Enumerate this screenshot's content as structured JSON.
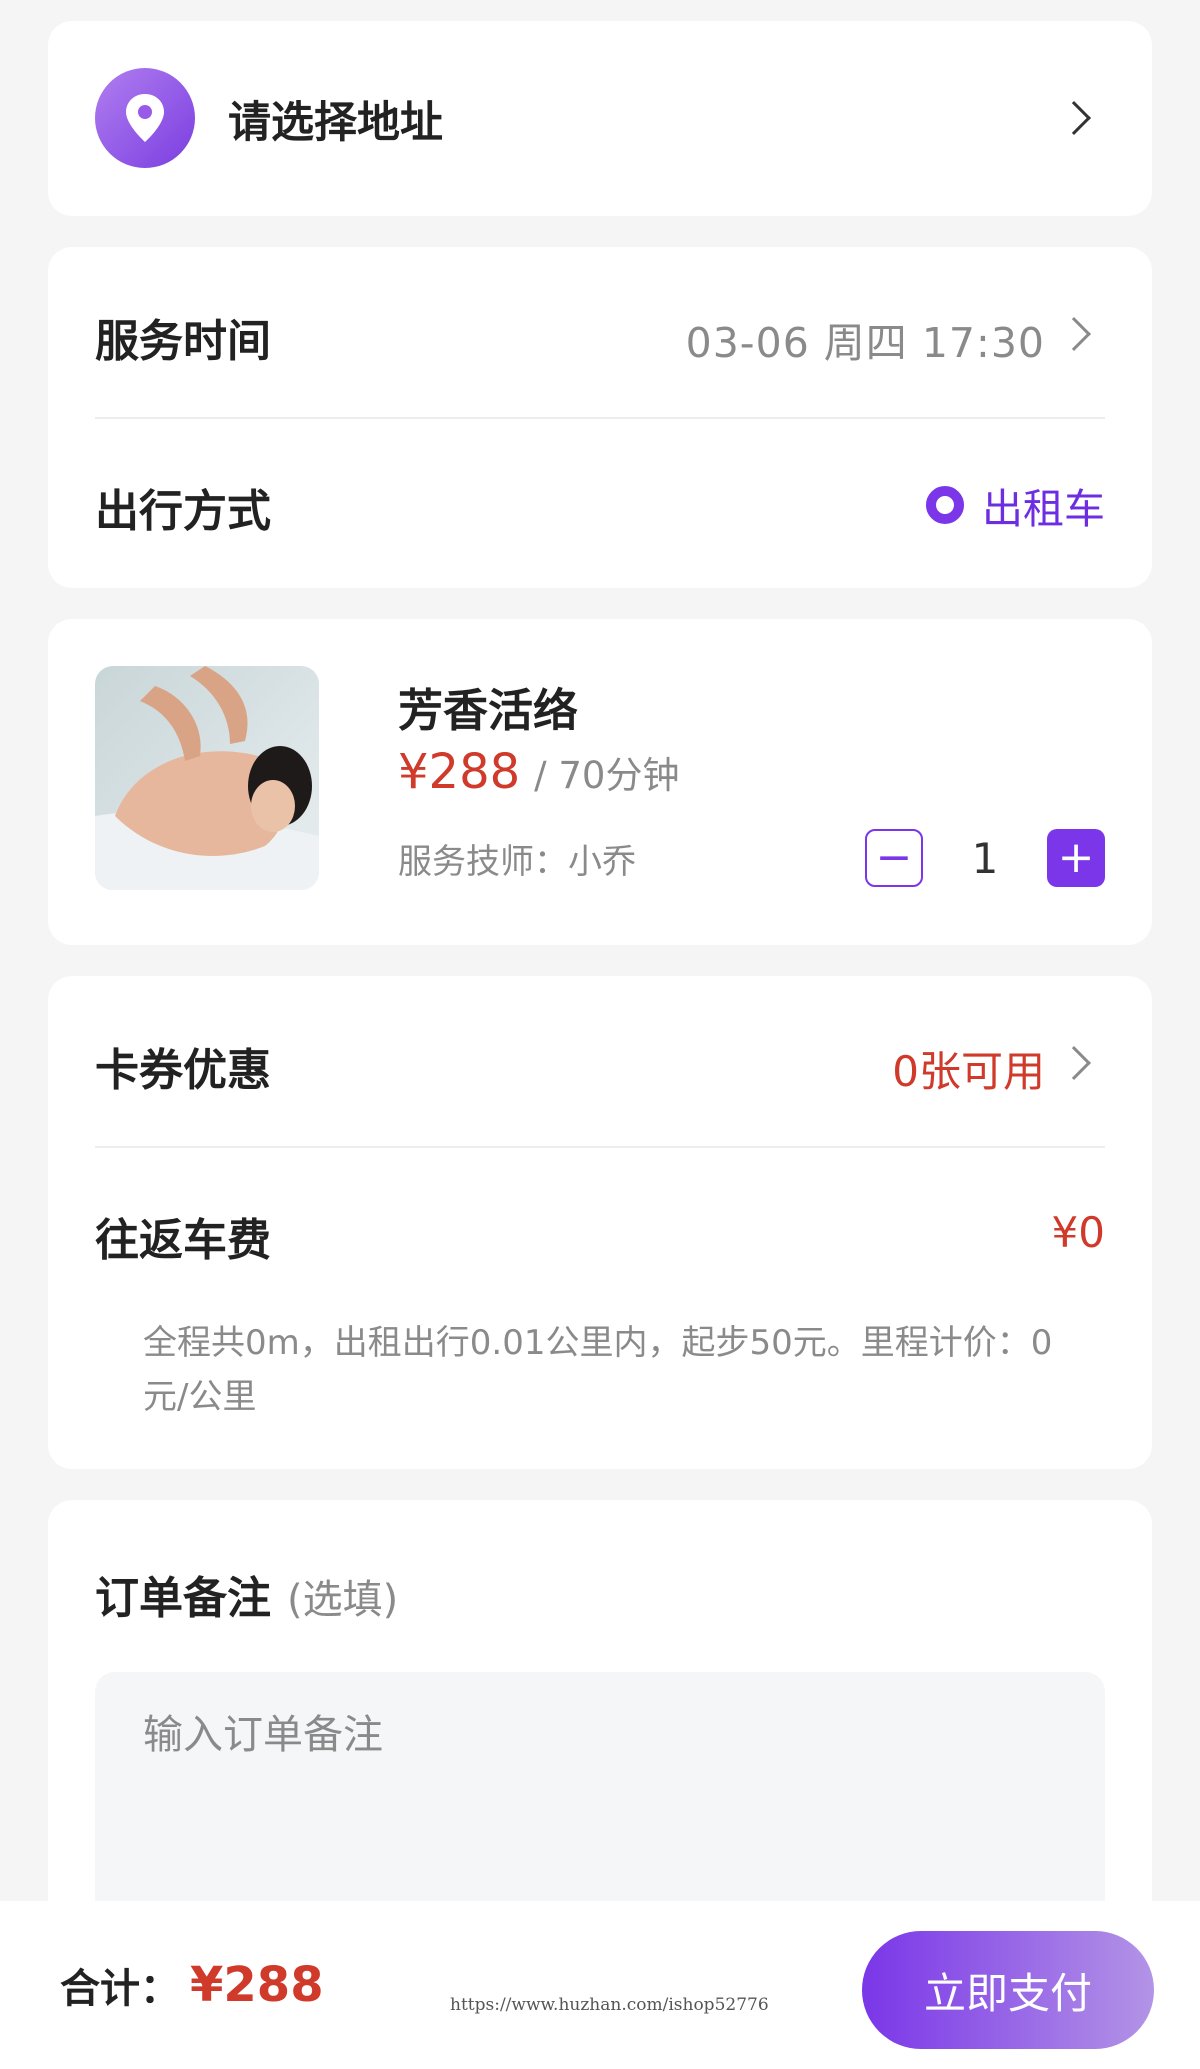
{
  "address": {
    "label": "请选择地址",
    "icon": "location-pin-icon"
  },
  "service_time": {
    "label": "服务时间",
    "value": "03-06 周四 17:30"
  },
  "travel": {
    "label": "出行方式",
    "option": "出租车"
  },
  "service": {
    "name": "芳香活络",
    "price": "¥288",
    "duration": "/ 70分钟",
    "technician": "服务技师：小乔",
    "quantity": "1",
    "minus": "−",
    "plus": "+"
  },
  "coupon": {
    "label": "卡券优惠",
    "value": "0张可用"
  },
  "fare": {
    "label": "往返车费",
    "value": "¥0",
    "note": "全程共0m，出租出行0.01公里内，起步50元。里程计价：0元/公里"
  },
  "remark": {
    "title": "订单备注",
    "optional": "(选填)",
    "placeholder": "输入订单备注",
    "value": ""
  },
  "footer": {
    "total_label": "合计：",
    "total_value": "¥288",
    "watermark": "https://www.huzhan.com/ishop52776",
    "pay_label": "立即支付"
  },
  "colors": {
    "accent": "#7a36e8",
    "price": "#cf3a2a"
  }
}
